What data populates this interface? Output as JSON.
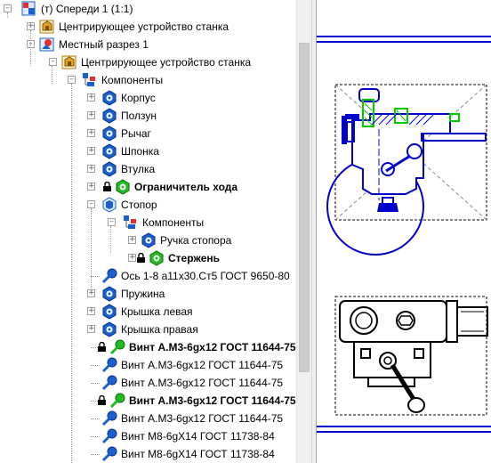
{
  "tree": {
    "items": [
      {
        "label": "(т) Спереди 1 (1:1)",
        "bold": false,
        "expander": "minus",
        "icon": "view-icon",
        "pre": ""
      },
      {
        "label": "Центрирующее устройство станка",
        "bold": false,
        "expander": "plus",
        "icon": "assembly-icon",
        "pre": ""
      },
      {
        "label": "Местный разрез 1",
        "bold": false,
        "expander": "minus",
        "icon": "section-icon",
        "pre": ""
      },
      {
        "label": "Центрирующее устройство станка",
        "bold": false,
        "expander": "minus",
        "icon": "assembly-icon",
        "pre": ""
      },
      {
        "label": "Компоненты",
        "bold": false,
        "expander": "minus",
        "icon": "components-icon",
        "pre": ""
      },
      {
        "label": "Корпус",
        "bold": false,
        "expander": "plus",
        "icon": "part-icon",
        "pre": ""
      },
      {
        "label": "Ползун",
        "bold": false,
        "expander": "plus",
        "icon": "part-icon",
        "pre": ""
      },
      {
        "label": "Рычаг",
        "bold": false,
        "expander": "plus",
        "icon": "part-icon",
        "pre": ""
      },
      {
        "label": "Шпонка",
        "bold": false,
        "expander": "plus",
        "icon": "part-icon",
        "pre": ""
      },
      {
        "label": "Втулка",
        "bold": false,
        "expander": "plus",
        "icon": "part-icon",
        "pre": ""
      },
      {
        "label": "Ограничитель хода",
        "bold": true,
        "expander": "plus",
        "icon": "part-icon-green",
        "pre": "lock-icon"
      },
      {
        "label": "Стопор",
        "bold": false,
        "expander": "minus",
        "icon": "subassembly-icon",
        "pre": ""
      },
      {
        "label": "Компоненты",
        "bold": false,
        "expander": "minus",
        "icon": "components-icon",
        "pre": ""
      },
      {
        "label": "Ручка стопора",
        "bold": false,
        "expander": "plus",
        "icon": "part-icon",
        "pre": ""
      },
      {
        "label": "Стержень",
        "bold": true,
        "expander": "plus",
        "icon": "part-icon-green",
        "pre": "lock-icon"
      },
      {
        "label": "Ось 1-8 а11х30.Ст5 ГОСТ 9650-80",
        "bold": false,
        "expander": "",
        "icon": "fastener-icon",
        "pre": ""
      },
      {
        "label": "Пружина",
        "bold": false,
        "expander": "plus",
        "icon": "part-icon",
        "pre": ""
      },
      {
        "label": "Крышка левая",
        "bold": false,
        "expander": "plus",
        "icon": "part-icon",
        "pre": ""
      },
      {
        "label": "Крышка правая",
        "bold": false,
        "expander": "plus",
        "icon": "part-icon",
        "pre": ""
      },
      {
        "label": "Винт А.М3-6gx12 ГОСТ 11644-75",
        "bold": true,
        "expander": "",
        "icon": "fastener-icon-green",
        "pre": "lock-icon"
      },
      {
        "label": "Винт А.М3-6gx12 ГОСТ 11644-75",
        "bold": false,
        "expander": "",
        "icon": "fastener-icon",
        "pre": ""
      },
      {
        "label": "Винт А.М3-6gx12 ГОСТ 11644-75",
        "bold": false,
        "expander": "",
        "icon": "fastener-icon",
        "pre": ""
      },
      {
        "label": "Винт А.М3-6gx12 ГОСТ 11644-75",
        "bold": true,
        "expander": "",
        "icon": "fastener-icon-green",
        "pre": "lock-icon"
      },
      {
        "label": "Винт А.М3-6gx12 ГОСТ 11644-75",
        "bold": false,
        "expander": "",
        "icon": "fastener-icon",
        "pre": ""
      },
      {
        "label": "Винт М8-6gX14 ГОСТ 11738-84",
        "bold": false,
        "expander": "",
        "icon": "fastener-icon",
        "pre": ""
      },
      {
        "label": "Винт М8-6gX14 ГОСТ 11738-84",
        "bold": false,
        "expander": "",
        "icon": "fastener-icon",
        "pre": ""
      }
    ]
  },
  "colors": {
    "drawing_blue": "#0000cc",
    "drawing_green": "#00cc00",
    "icon_blue": "#1a5fd0",
    "icon_green": "#22bb22",
    "scroll_thumb": "#cdcdcd"
  }
}
